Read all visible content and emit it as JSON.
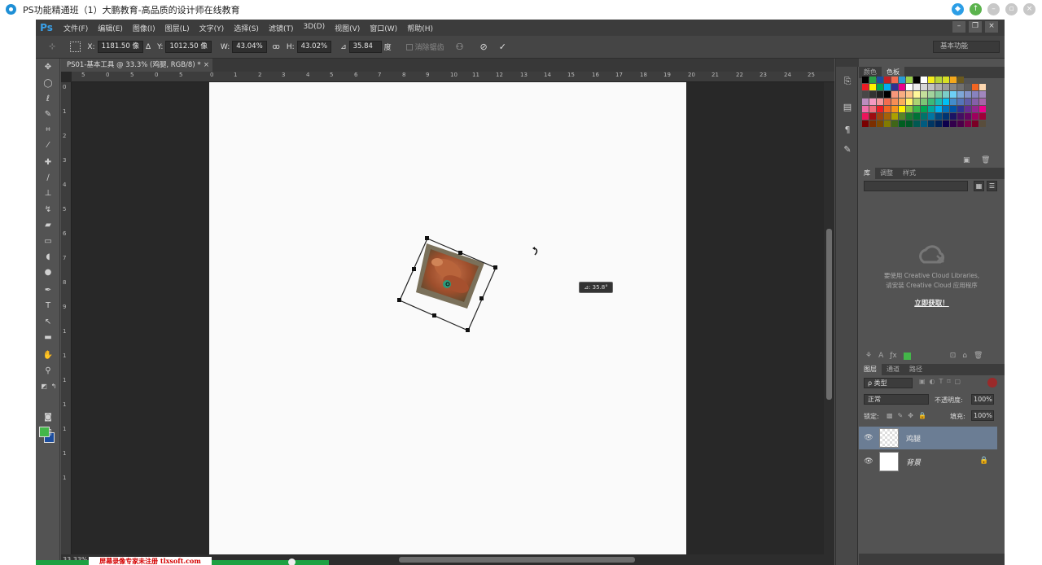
{
  "window": {
    "title": "PS功能精通班（1）大鹏教育-高品质的设计师在线教育",
    "buttons": [
      "pin",
      "up",
      "min",
      "restore",
      "close"
    ]
  },
  "app": {
    "logo": "Ps",
    "menu": [
      "文件(F)",
      "编辑(E)",
      "图像(I)",
      "图层(L)",
      "文字(Y)",
      "选择(S)",
      "滤镜(T)",
      "3D(D)",
      "视图(V)",
      "窗口(W)",
      "帮助(H)"
    ],
    "workspace": "基本功能"
  },
  "options": {
    "x_label": "X:",
    "x_value": "1181.50 像",
    "delta_symbol": "Δ",
    "y_label": "Y:",
    "y_value": "1012.50 像",
    "w_label": "W:",
    "w_value": "43.04%",
    "link_symbol": "ꝏ",
    "h_label": "H:",
    "h_value": "43.02%",
    "angle_symbol": "⊿",
    "angle_value": "35.84",
    "angle_unit": "度",
    "interp_label": "消除锯齿"
  },
  "document": {
    "tab_title": "PS01-基本工具 @ 33.3% (鸡腿, RGB/8) *",
    "close": "×",
    "zoom": "33.33%",
    "rotation_tooltip": "⊿: 35.8°",
    "ruler_h": [
      "5",
      "0",
      "5",
      "0",
      "5",
      "0",
      "1",
      "2",
      "3",
      "4",
      "5",
      "6",
      "7",
      "8",
      "9",
      "10",
      "11",
      "12",
      "13",
      "14",
      "15",
      "16",
      "17",
      "18",
      "19",
      "20",
      "21",
      "22",
      "23",
      "24",
      "25"
    ],
    "ruler_v": [
      "0",
      "1",
      "2",
      "3",
      "4",
      "5",
      "6",
      "7",
      "8",
      "9",
      "1",
      "1",
      "1",
      "1",
      "1",
      "1",
      "1"
    ]
  },
  "panels": {
    "color_tabs": [
      "颜色",
      "色板"
    ],
    "lib_tabs": [
      "库",
      "调整",
      "样式"
    ],
    "cc_line1": "要使用 Creative Cloud Libraries,",
    "cc_line2": "请安装 Creative Cloud 应用程序",
    "cc_link": "立即获取！",
    "layer_tabs": [
      "图层",
      "通道",
      "路径"
    ],
    "filter_label": "ρ 类型",
    "blend_mode": "正常",
    "opacity_label": "不透明度:",
    "opacity_value": "100%",
    "lock_label": "锁定:",
    "fill_label": "填充:",
    "fill_value": "100%",
    "layers": [
      {
        "name": "鸡腿",
        "selected": true
      },
      {
        "name": "背景",
        "selected": false,
        "locked": true
      }
    ]
  },
  "overlay": {
    "watermark": "屏幕录像专家未注册 tlxsoft.com"
  },
  "colors": {
    "foreground": "#43b649",
    "background": "#1c4d9e",
    "accent": "#1e8fd6"
  }
}
